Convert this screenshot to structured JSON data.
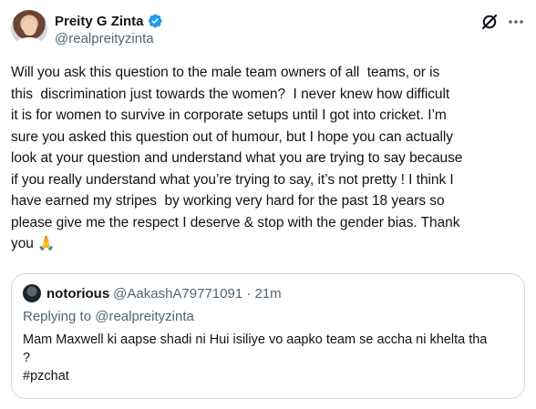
{
  "post": {
    "author": {
      "display_name": "Preity G Zinta",
      "handle": "@realpreityzinta",
      "verified": true,
      "verified_color": "#1d9bf0"
    },
    "text": "Will you ask this question to the male team owners of all  teams, or is\nthis  discrimination just towards the women?  I never knew how difficult\nit is for women to survive in corporate setups until I got into cricket. I’m\nsure you asked this question out of humour, but I hope you can actually\nlook at your question and understand what you are trying to say because\nif you really understand what you’re trying to say, it’s not pretty ! I think I\nhave earned my stripes  by working very hard for the past 18 years so\nplease give me the respect I deserve & stop with the gender bias. Thank\nyou 🙏",
    "icons": {
      "grok": "grok-icon",
      "more": "more-icon"
    }
  },
  "quote": {
    "display_name": "notorious",
    "meta": "@AakashA79771091 · 21m",
    "replying_prefix": "Replying to ",
    "replying_handle": "@realpreityzinta",
    "text": "Mam Maxwell ki aapse shadi ni Hui isiliye vo aapko team se accha ni khelta tha\n?\n#pzchat"
  },
  "colors": {
    "text": "#0f1419",
    "secondary": "#536471",
    "border": "#cfd9de"
  }
}
